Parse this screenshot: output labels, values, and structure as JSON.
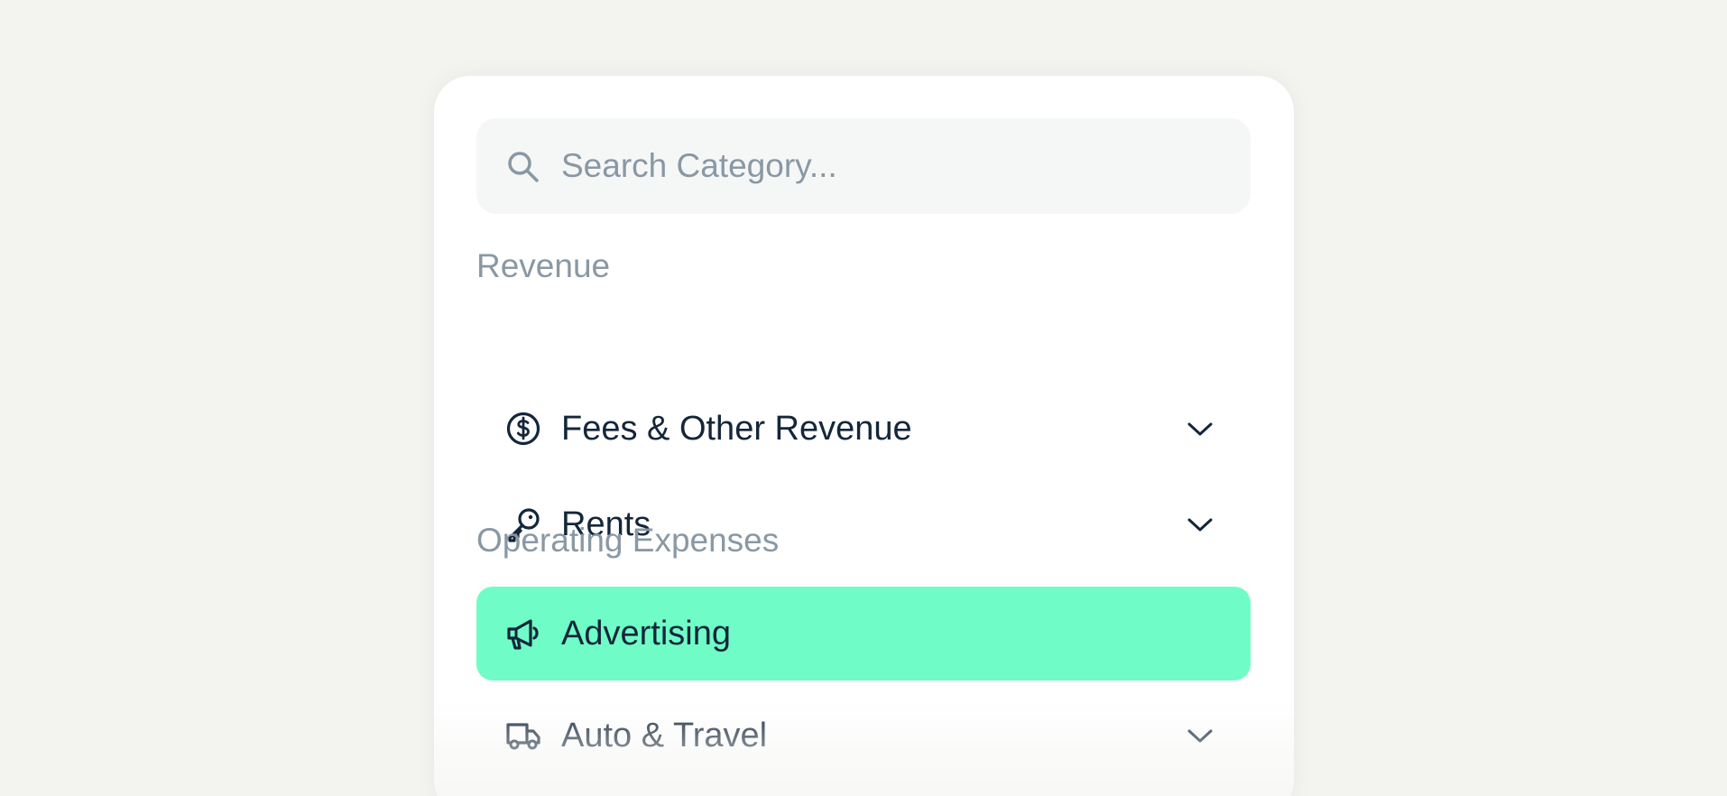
{
  "search": {
    "placeholder": "Search Category...",
    "icon": "search-icon"
  },
  "sections": [
    {
      "label": "Revenue",
      "items": [
        {
          "label": "Fees & Other Revenue",
          "icon": "dollar-circle-icon",
          "expandable": true
        },
        {
          "label": "Rents",
          "icon": "key-icon",
          "expandable": true
        }
      ]
    },
    {
      "label": "Operating Expenses",
      "items": [
        {
          "label": "Advertising",
          "icon": "megaphone-icon",
          "expandable": false,
          "selected": true
        },
        {
          "label": "Auto & Travel",
          "icon": "truck-icon",
          "expandable": true
        }
      ]
    }
  ],
  "colors": {
    "selected_bg": "#70fcc6",
    "text_dark": "#14263a",
    "text_muted": "#8a98a4",
    "search_bg": "#f5f7f7",
    "page_bg": "#f3f3f0"
  }
}
